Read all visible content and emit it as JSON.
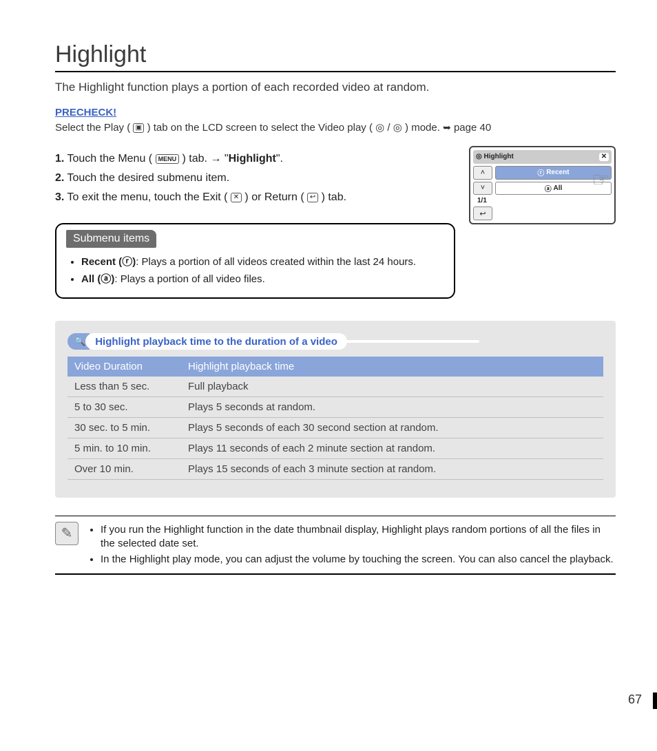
{
  "title": "Highlight",
  "intro": "The Highlight function plays a portion of each recorded video at random.",
  "precheck_label": "PRECHECK!",
  "precheck": {
    "before_play": "Select the Play (",
    "after_play": ") tab on the LCD screen to select the Video play (",
    "after_vp": " /",
    "after_vp2": " ) mode. ",
    "page_ref": "page 40"
  },
  "icons": {
    "play_tab": "▣",
    "video_play_a": "◎",
    "video_play_b": "◎",
    "menu_tab": "MENU",
    "exit_tab": "✕",
    "return_tab": "↩",
    "note": "✎",
    "search": "🔍",
    "small_recent": "ⓡ",
    "small_all": "ⓐ"
  },
  "steps": [
    {
      "before_icon": "Touch the Menu (",
      "after_icon": ") tab. → \"",
      "bold": "Highlight",
      "after_bold": "\"."
    },
    {
      "text": "Touch the desired submenu item."
    },
    {
      "p1": "To exit the menu, touch the Exit (",
      "p2": ") or Return (",
      "p3": ") tab."
    }
  ],
  "device": {
    "title": "Highlight",
    "close": "✕",
    "up": "˄",
    "down": "˅",
    "recent": "Recent",
    "all": "All",
    "page": "1/1",
    "back": "↩"
  },
  "submenu": {
    "heading": "Submenu items",
    "items": [
      {
        "label": "Recent (",
        "icon": "ⓡ",
        "label2": ")",
        "desc": ": Plays a portion of all videos created within the last 24 hours."
      },
      {
        "label": "All (",
        "icon": "ⓐ",
        "label2": ")",
        "desc": ": Plays a portion of all video files."
      }
    ]
  },
  "table": {
    "caption": "Highlight playback time to the duration of a video",
    "headers": [
      "Video Duration",
      "Highlight playback time"
    ],
    "rows": [
      [
        "Less than 5 sec.",
        "Full playback"
      ],
      [
        "5 to 30 sec.",
        "Plays 5 seconds at random."
      ],
      [
        "30 sec. to 5 min.",
        "Plays 5 seconds of each 30 second section at random."
      ],
      [
        "5 min. to 10 min.",
        "Plays 11 seconds of each 2 minute section at random."
      ],
      [
        "Over 10 min.",
        "Plays 15 seconds of each 3 minute section at random."
      ]
    ]
  },
  "notes": [
    "If you run the Highlight function in the date thumbnail display, Highlight plays random portions of all the files in the selected date set.",
    "In the Highlight play mode, you can adjust the volume by touching the screen. You can also cancel the playback."
  ],
  "page_number": "67"
}
